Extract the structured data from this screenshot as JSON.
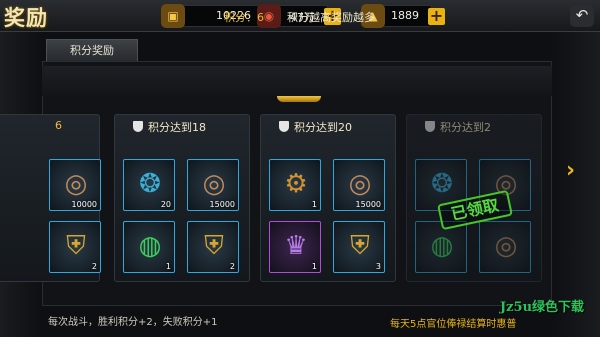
{
  "header": {
    "title": "奖励",
    "resources": [
      {
        "icon": "gold-ingot-icon",
        "value": "10226"
      },
      {
        "icon": "ruby-coin-icon",
        "value": "47万"
      },
      {
        "icon": "gold-pile-icon",
        "value": "1889"
      }
    ],
    "plus": "+",
    "back": "↶"
  },
  "tab": {
    "label": "积分奖励"
  },
  "score": {
    "label": "积分：6",
    "hint": "积分越高奖励越多"
  },
  "nav": {
    "prev": "‹",
    "next": "›"
  },
  "cards": [
    {
      "title": "6",
      "items": [
        {
          "icon": "coin-stack-icon",
          "count": ""
        },
        {
          "icon": "coin-stack-icon",
          "count": "10000"
        },
        {
          "icon": "golden-armor-icon",
          "count": "2"
        },
        {
          "icon": "golden-armor-icon",
          "count": "2"
        }
      ]
    },
    {
      "title": "积分达到18",
      "items": [
        {
          "icon": "dragon-orb-icon",
          "count": "20"
        },
        {
          "icon": "coin-stack-icon",
          "count": "15000"
        },
        {
          "icon": "jade-orb-icon",
          "count": "1"
        },
        {
          "icon": "golden-armor-icon",
          "count": "2"
        }
      ]
    },
    {
      "title": "积分达到20",
      "items": [
        {
          "icon": "gear-box-icon",
          "count": "1"
        },
        {
          "icon": "coin-stack-icon",
          "count": "15000"
        },
        {
          "icon": "purple-crest-icon",
          "count": "1"
        },
        {
          "icon": "golden-armor-icon",
          "count": "3"
        }
      ]
    },
    {
      "title": "积分达到2",
      "items": [
        {
          "icon": "dragon-orb-icon",
          "count": ""
        },
        {
          "icon": "coin-stack-icon",
          "count": ""
        },
        {
          "icon": "jade-orb-icon",
          "count": ""
        },
        {
          "icon": "coin-stack-icon",
          "count": ""
        }
      ]
    }
  ],
  "claimed_stamp": "已领取",
  "footer": {
    "left": "每次战斗，胜利积分+2，失败积分+1",
    "right": "每天5点官位俸禄结算时惠普"
  },
  "watermark": "Jz5u绿色下载"
}
